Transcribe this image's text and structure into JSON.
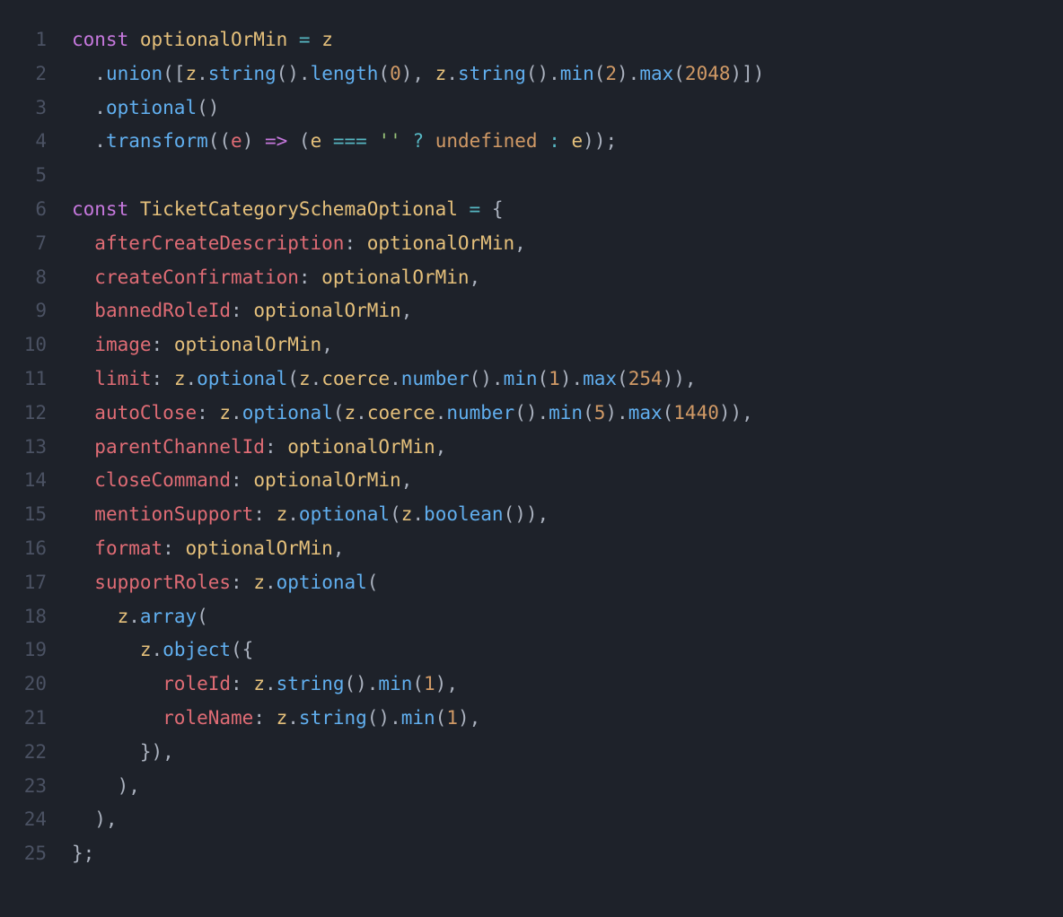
{
  "lines": [
    {
      "n": "1",
      "tokens": [
        [
          "kw",
          "const"
        ],
        [
          "punct",
          " "
        ],
        [
          "decl",
          "optionalOrMin"
        ],
        [
          "punct",
          " "
        ],
        [
          "op",
          "="
        ],
        [
          "punct",
          " "
        ],
        [
          "var",
          "z"
        ]
      ]
    },
    {
      "n": "2",
      "tokens": [
        [
          "punct",
          "  ."
        ],
        [
          "fn",
          "union"
        ],
        [
          "punct",
          "(["
        ],
        [
          "var",
          "z"
        ],
        [
          "punct",
          "."
        ],
        [
          "fn",
          "string"
        ],
        [
          "punct",
          "()."
        ],
        [
          "fn",
          "length"
        ],
        [
          "punct",
          "("
        ],
        [
          "num",
          "0"
        ],
        [
          "punct",
          "), "
        ],
        [
          "var",
          "z"
        ],
        [
          "punct",
          "."
        ],
        [
          "fn",
          "string"
        ],
        [
          "punct",
          "()."
        ],
        [
          "fn",
          "min"
        ],
        [
          "punct",
          "("
        ],
        [
          "num",
          "2"
        ],
        [
          "punct",
          ")."
        ],
        [
          "fn",
          "max"
        ],
        [
          "punct",
          "("
        ],
        [
          "num",
          "2048"
        ],
        [
          "punct",
          ")])"
        ]
      ]
    },
    {
      "n": "3",
      "tokens": [
        [
          "punct",
          "  ."
        ],
        [
          "fn",
          "optional"
        ],
        [
          "punct",
          "()"
        ]
      ]
    },
    {
      "n": "4",
      "tokens": [
        [
          "punct",
          "  ."
        ],
        [
          "fn",
          "transform"
        ],
        [
          "punct",
          "(("
        ],
        [
          "param",
          "e"
        ],
        [
          "punct",
          ") "
        ],
        [
          "kw",
          "=>"
        ],
        [
          "punct",
          " ("
        ],
        [
          "var",
          "e"
        ],
        [
          "punct",
          " "
        ],
        [
          "op",
          "==="
        ],
        [
          "punct",
          " "
        ],
        [
          "str",
          "''"
        ],
        [
          "punct",
          " "
        ],
        [
          "op",
          "?"
        ],
        [
          "punct",
          " "
        ],
        [
          "kw2",
          "undefined"
        ],
        [
          "punct",
          " "
        ],
        [
          "op",
          ":"
        ],
        [
          "punct",
          " "
        ],
        [
          "var",
          "e"
        ],
        [
          "punct",
          "));"
        ]
      ]
    },
    {
      "n": "5",
      "tokens": [
        [
          "punct",
          ""
        ]
      ]
    },
    {
      "n": "6",
      "tokens": [
        [
          "kw",
          "const"
        ],
        [
          "punct",
          " "
        ],
        [
          "decl",
          "TicketCategorySchemaOptional"
        ],
        [
          "punct",
          " "
        ],
        [
          "op",
          "="
        ],
        [
          "punct",
          " {"
        ]
      ]
    },
    {
      "n": "7",
      "tokens": [
        [
          "punct",
          "  "
        ],
        [
          "prop",
          "afterCreateDescription"
        ],
        [
          "punct",
          ": "
        ],
        [
          "var",
          "optionalOrMin"
        ],
        [
          "punct",
          ","
        ]
      ]
    },
    {
      "n": "8",
      "tokens": [
        [
          "punct",
          "  "
        ],
        [
          "prop",
          "createConfirmation"
        ],
        [
          "punct",
          ": "
        ],
        [
          "var",
          "optionalOrMin"
        ],
        [
          "punct",
          ","
        ]
      ]
    },
    {
      "n": "9",
      "tokens": [
        [
          "punct",
          "  "
        ],
        [
          "prop",
          "bannedRoleId"
        ],
        [
          "punct",
          ": "
        ],
        [
          "var",
          "optionalOrMin"
        ],
        [
          "punct",
          ","
        ]
      ]
    },
    {
      "n": "10",
      "tokens": [
        [
          "punct",
          "  "
        ],
        [
          "prop",
          "image"
        ],
        [
          "punct",
          ": "
        ],
        [
          "var",
          "optionalOrMin"
        ],
        [
          "punct",
          ","
        ]
      ]
    },
    {
      "n": "11",
      "tokens": [
        [
          "punct",
          "  "
        ],
        [
          "prop",
          "limit"
        ],
        [
          "punct",
          ": "
        ],
        [
          "var",
          "z"
        ],
        [
          "punct",
          "."
        ],
        [
          "fn",
          "optional"
        ],
        [
          "punct",
          "("
        ],
        [
          "var",
          "z"
        ],
        [
          "punct",
          "."
        ],
        [
          "var",
          "coerce"
        ],
        [
          "punct",
          "."
        ],
        [
          "fn",
          "number"
        ],
        [
          "punct",
          "()."
        ],
        [
          "fn",
          "min"
        ],
        [
          "punct",
          "("
        ],
        [
          "num",
          "1"
        ],
        [
          "punct",
          ")."
        ],
        [
          "fn",
          "max"
        ],
        [
          "punct",
          "("
        ],
        [
          "num",
          "254"
        ],
        [
          "punct",
          ")),"
        ]
      ]
    },
    {
      "n": "12",
      "tokens": [
        [
          "punct",
          "  "
        ],
        [
          "prop",
          "autoClose"
        ],
        [
          "punct",
          ": "
        ],
        [
          "var",
          "z"
        ],
        [
          "punct",
          "."
        ],
        [
          "fn",
          "optional"
        ],
        [
          "punct",
          "("
        ],
        [
          "var",
          "z"
        ],
        [
          "punct",
          "."
        ],
        [
          "var",
          "coerce"
        ],
        [
          "punct",
          "."
        ],
        [
          "fn",
          "number"
        ],
        [
          "punct",
          "()."
        ],
        [
          "fn",
          "min"
        ],
        [
          "punct",
          "("
        ],
        [
          "num",
          "5"
        ],
        [
          "punct",
          ")."
        ],
        [
          "fn",
          "max"
        ],
        [
          "punct",
          "("
        ],
        [
          "num",
          "1440"
        ],
        [
          "punct",
          ")),"
        ]
      ]
    },
    {
      "n": "13",
      "tokens": [
        [
          "punct",
          "  "
        ],
        [
          "prop",
          "parentChannelId"
        ],
        [
          "punct",
          ": "
        ],
        [
          "var",
          "optionalOrMin"
        ],
        [
          "punct",
          ","
        ]
      ]
    },
    {
      "n": "14",
      "tokens": [
        [
          "punct",
          "  "
        ],
        [
          "prop",
          "closeCommand"
        ],
        [
          "punct",
          ": "
        ],
        [
          "var",
          "optionalOrMin"
        ],
        [
          "punct",
          ","
        ]
      ]
    },
    {
      "n": "15",
      "tokens": [
        [
          "punct",
          "  "
        ],
        [
          "prop",
          "mentionSupport"
        ],
        [
          "punct",
          ": "
        ],
        [
          "var",
          "z"
        ],
        [
          "punct",
          "."
        ],
        [
          "fn",
          "optional"
        ],
        [
          "punct",
          "("
        ],
        [
          "var",
          "z"
        ],
        [
          "punct",
          "."
        ],
        [
          "fn",
          "boolean"
        ],
        [
          "punct",
          "()),"
        ]
      ]
    },
    {
      "n": "16",
      "tokens": [
        [
          "punct",
          "  "
        ],
        [
          "prop",
          "format"
        ],
        [
          "punct",
          ": "
        ],
        [
          "var",
          "optionalOrMin"
        ],
        [
          "punct",
          ","
        ]
      ]
    },
    {
      "n": "17",
      "tokens": [
        [
          "punct",
          "  "
        ],
        [
          "prop",
          "supportRoles"
        ],
        [
          "punct",
          ": "
        ],
        [
          "var",
          "z"
        ],
        [
          "punct",
          "."
        ],
        [
          "fn",
          "optional"
        ],
        [
          "punct",
          "("
        ]
      ]
    },
    {
      "n": "18",
      "tokens": [
        [
          "punct",
          "    "
        ],
        [
          "var",
          "z"
        ],
        [
          "punct",
          "."
        ],
        [
          "fn",
          "array"
        ],
        [
          "punct",
          "("
        ]
      ]
    },
    {
      "n": "19",
      "tokens": [
        [
          "punct",
          "      "
        ],
        [
          "var",
          "z"
        ],
        [
          "punct",
          "."
        ],
        [
          "fn",
          "object"
        ],
        [
          "punct",
          "({"
        ]
      ]
    },
    {
      "n": "20",
      "tokens": [
        [
          "punct",
          "        "
        ],
        [
          "prop",
          "roleId"
        ],
        [
          "punct",
          ": "
        ],
        [
          "var",
          "z"
        ],
        [
          "punct",
          "."
        ],
        [
          "fn",
          "string"
        ],
        [
          "punct",
          "()."
        ],
        [
          "fn",
          "min"
        ],
        [
          "punct",
          "("
        ],
        [
          "num",
          "1"
        ],
        [
          "punct",
          "),"
        ]
      ]
    },
    {
      "n": "21",
      "tokens": [
        [
          "punct",
          "        "
        ],
        [
          "prop",
          "roleName"
        ],
        [
          "punct",
          ": "
        ],
        [
          "var",
          "z"
        ],
        [
          "punct",
          "."
        ],
        [
          "fn",
          "string"
        ],
        [
          "punct",
          "()."
        ],
        [
          "fn",
          "min"
        ],
        [
          "punct",
          "("
        ],
        [
          "num",
          "1"
        ],
        [
          "punct",
          "),"
        ]
      ]
    },
    {
      "n": "22",
      "tokens": [
        [
          "punct",
          "      }),"
        ]
      ]
    },
    {
      "n": "23",
      "tokens": [
        [
          "punct",
          "    ),"
        ]
      ]
    },
    {
      "n": "24",
      "tokens": [
        [
          "punct",
          "  ),"
        ]
      ]
    },
    {
      "n": "25",
      "tokens": [
        [
          "punct",
          "};"
        ]
      ]
    }
  ]
}
